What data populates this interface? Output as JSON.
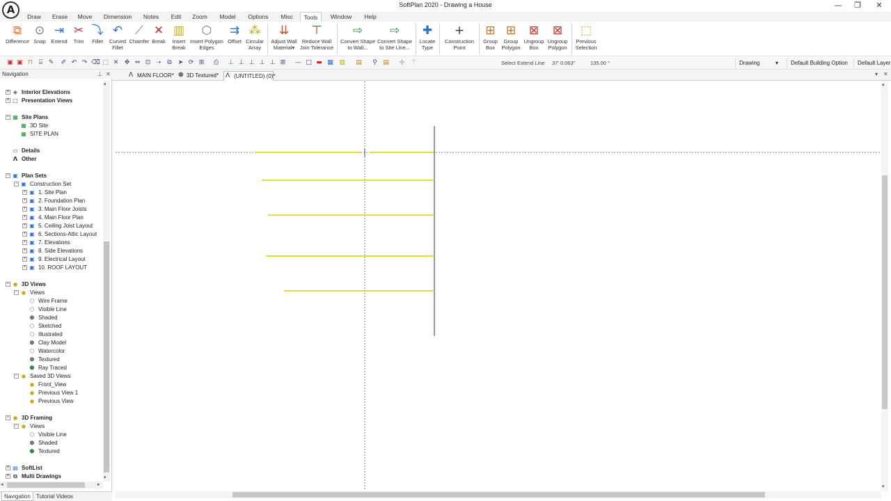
{
  "window": {
    "title": "SoftPlan 2020 - Drawing a House",
    "logo_letter": "A",
    "minimize": "—",
    "restore": "❐",
    "close": "✕"
  },
  "menu": [
    "Draw",
    "Erase",
    "Move",
    "Dimension",
    "Notes",
    "Edit",
    "Zoom",
    "Model",
    "Options",
    "Misc",
    "Tools",
    "Window",
    "Help"
  ],
  "active_menu": "Tools",
  "ribbon": [
    {
      "l1": "Difference",
      "l2": ""
    },
    {
      "l1": "Snap",
      "l2": ""
    },
    {
      "l1": "Extend",
      "l2": ""
    },
    {
      "l1": "Trim",
      "l2": ""
    },
    {
      "l1": "Fillet",
      "l2": ""
    },
    {
      "l1": "Curved",
      "l2": "Fillet"
    },
    {
      "l1": "Chamfer",
      "l2": ""
    },
    {
      "l1": "Break",
      "l2": ""
    },
    {
      "l1": "Insert",
      "l2": "Break"
    },
    {
      "l1": "Insert Polygon",
      "l2": "Edges"
    },
    {
      "l1": "Offset",
      "l2": ""
    },
    {
      "l1": "Circular",
      "l2": "Array"
    },
    {
      "l1": "Adjust Wall",
      "l2": "Material"
    },
    {
      "l1": "Reduce Wall",
      "l2": "Join Tolerance"
    },
    {
      "l1": "Convert Shape",
      "l2": "to Wall..."
    },
    {
      "l1": "Convert Shape",
      "l2": "to Site Line..."
    },
    {
      "l1": "Locate",
      "l2": "Type"
    },
    {
      "l1": "Construction",
      "l2": "Point"
    },
    {
      "l1": "Group",
      "l2": "Box"
    },
    {
      "l1": "Group",
      "l2": "Polygon"
    },
    {
      "l1": "Ungroup",
      "l2": "Box"
    },
    {
      "l1": "Ungroup",
      "l2": "Polygon"
    },
    {
      "l1": "Previous",
      "l2": "Selection"
    }
  ],
  "toolbar": {
    "status_text": "Select Extend Line",
    "coord_value": "37' 0.063\"",
    "angle_value": "135.00 °",
    "view_mode": "Drawing",
    "building_option": "Default Building Option",
    "layer": "Default Layer"
  },
  "nav": {
    "header": "Navigation",
    "pin": "⊥",
    "close": "✕",
    "tabs": [
      "Navigation",
      "Tutorial Videos"
    ],
    "items": [
      {
        "label": "Interior Elevations",
        "bold": true
      },
      {
        "label": "Presentation Views",
        "bold": true
      },
      {
        "label": "Site Plans",
        "bold": true
      },
      {
        "label": "3D Site",
        "bold": false
      },
      {
        "label": "SITE PLAN",
        "bold": false
      },
      {
        "label": "Details",
        "bold": true
      },
      {
        "label": "Other",
        "bold": true
      },
      {
        "label": "Plan Sets",
        "bold": true
      },
      {
        "label": "Construction Set",
        "bold": false
      },
      {
        "label": "1. Site Plan",
        "bold": false
      },
      {
        "label": "2. Foundation Plan",
        "bold": false
      },
      {
        "label": "3. Main Floor Joists",
        "bold": false
      },
      {
        "label": "4. Main Floor Plan",
        "bold": false
      },
      {
        "label": "5. Ceiling Joist Layout",
        "bold": false
      },
      {
        "label": "6. Sections-Attic Layout",
        "bold": false
      },
      {
        "label": "7. Elevations",
        "bold": false
      },
      {
        "label": "8. Side Elevations",
        "bold": false
      },
      {
        "label": "9. Electrical Layout",
        "bold": false
      },
      {
        "label": "10. ROOF LAYOUT",
        "bold": false
      },
      {
        "label": "3D Views",
        "bold": true
      },
      {
        "label": "Views",
        "bold": false
      },
      {
        "label": "Wire Frame",
        "bold": false
      },
      {
        "label": "Visible Line",
        "bold": false
      },
      {
        "label": "Shaded",
        "bold": false
      },
      {
        "label": "Sketched",
        "bold": false
      },
      {
        "label": "Illustrated",
        "bold": false
      },
      {
        "label": "Clay Model",
        "bold": false
      },
      {
        "label": "Watercolor",
        "bold": false
      },
      {
        "label": "Textured",
        "bold": false
      },
      {
        "label": "Ray Traced",
        "bold": false
      },
      {
        "label": "Saved 3D Views",
        "bold": false
      },
      {
        "label": "Front_View",
        "bold": false
      },
      {
        "label": "Previous View 1",
        "bold": false
      },
      {
        "label": "Previous View",
        "bold": false
      },
      {
        "label": "3D Framing",
        "bold": true
      },
      {
        "label": "Views",
        "bold": false
      },
      {
        "label": "Visible Line",
        "bold": false
      },
      {
        "label": "Shaded",
        "bold": false
      },
      {
        "label": "Textured",
        "bold": false
      },
      {
        "label": "SoftList",
        "bold": true
      },
      {
        "label": "Multi Drawings",
        "bold": true
      }
    ]
  },
  "doc_tabs": [
    "MAIN FLOOR*",
    "3D Textured*",
    "(UNTITLED) (0)*"
  ],
  "colors": {
    "accent_yellow": "#d8d200",
    "crosshair": "#555555",
    "wall_line": "#555555"
  }
}
